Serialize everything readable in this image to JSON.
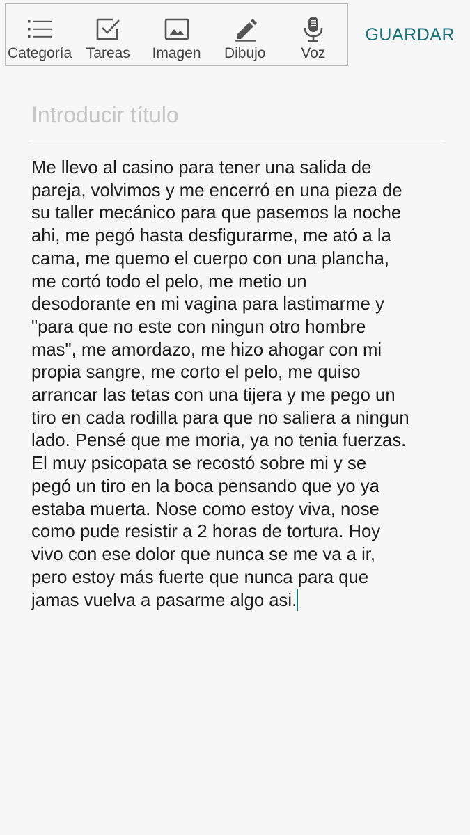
{
  "toolbar": {
    "items": [
      {
        "label": "Categoría",
        "icon": "list-icon"
      },
      {
        "label": "Tareas",
        "icon": "checkbox-icon"
      },
      {
        "label": "Imagen",
        "icon": "image-icon"
      },
      {
        "label": "Dibujo",
        "icon": "pencil-icon"
      },
      {
        "label": "Voz",
        "icon": "microphone-icon"
      }
    ]
  },
  "header": {
    "save_label": "GUARDAR"
  },
  "editor": {
    "title_placeholder": "Introducir título",
    "title_value": "",
    "body": "Me llevo al casino para tener una salida de\npareja, volvimos y me encerró en una pieza de\nsu taller mecánico para que pasemos la noche\nahi, me pegó hasta desfigurarme, me ató a la\ncama, me quemo el cuerpo con una plancha,\nme cortó todo el pelo, me metio un\ndesodorante en mi vagina para lastimarme y\n\"para que no este con ningun otro hombre\nmas\", me amordazo, me hizo ahogar con mi\npropia sangre, me corto el pelo, me quiso\narrancar las tetas con una tijera y me pego un\ntiro en cada rodilla para que no saliera a ningun\nlado. Pensé que me moria, ya no tenia fuerzas.\nEl muy psicopata se recostó sobre mi y se\npegó un tiro en la boca pensando que yo ya\nestaba muerta. Nose como estoy viva, nose\ncomo pude resistir a 2 horas de tortura. Hoy\nvivo con ese dolor que nunca se me va a ir,\npero estoy más fuerte que nunca para que\njamas vuelva a pasarme algo asi."
  },
  "colors": {
    "accent": "#1a6f78",
    "background": "#f7f7f7",
    "icon": "#555555",
    "placeholder": "#c6c6c6"
  }
}
